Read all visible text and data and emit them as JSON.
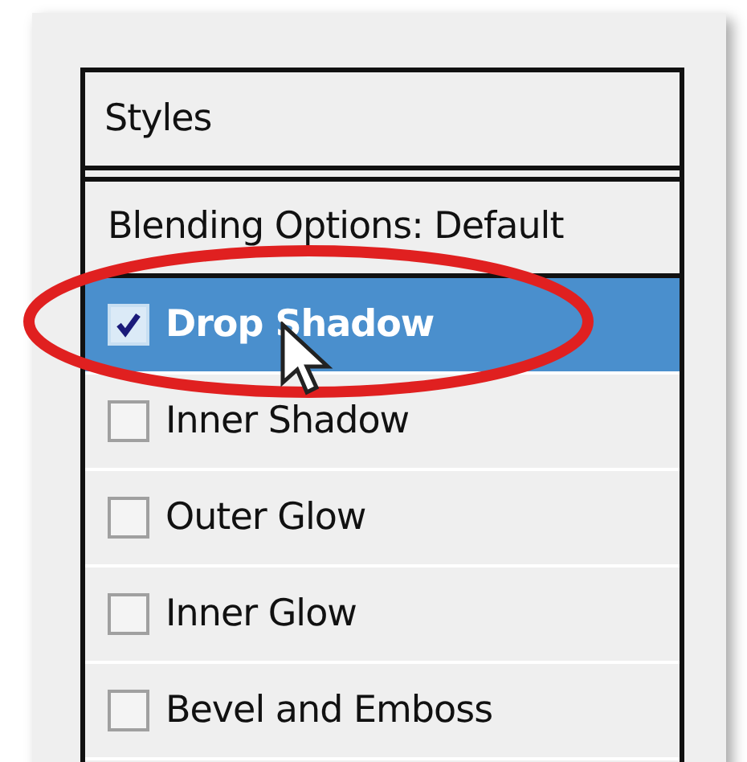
{
  "panel": {
    "title": "Styles"
  },
  "items": [
    {
      "kind": "option",
      "label": "Blending Options: Default",
      "selected": false
    },
    {
      "kind": "effect",
      "label": "Drop Shadow",
      "checked": true,
      "selected": true
    },
    {
      "kind": "effect",
      "label": "Inner Shadow",
      "checked": false,
      "selected": false
    },
    {
      "kind": "effect",
      "label": "Outer Glow",
      "checked": false,
      "selected": false
    },
    {
      "kind": "effect",
      "label": "Inner Glow",
      "checked": false,
      "selected": false
    },
    {
      "kind": "effect",
      "label": "Bevel and Emboss",
      "checked": false,
      "selected": false
    }
  ]
}
